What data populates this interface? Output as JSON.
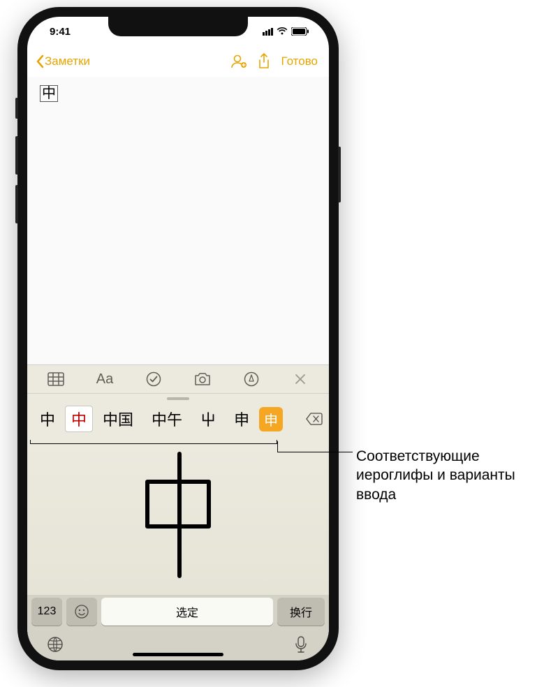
{
  "status": {
    "time": "9:41"
  },
  "nav": {
    "back_label": "Заметки",
    "done_label": "Готово"
  },
  "note": {
    "content": "中"
  },
  "toolbar": {
    "format_label": "Aa"
  },
  "candidates": {
    "items": [
      "中",
      "中",
      "中国",
      "中午",
      "屮",
      "申",
      "申"
    ],
    "highlight_index": 1,
    "orange_index": 6
  },
  "keyboard": {
    "numeric_label": "123",
    "space_label": "选定",
    "return_label": "换行"
  },
  "callout": {
    "text": "Соответствующие иероглифы и варианты ввода"
  }
}
